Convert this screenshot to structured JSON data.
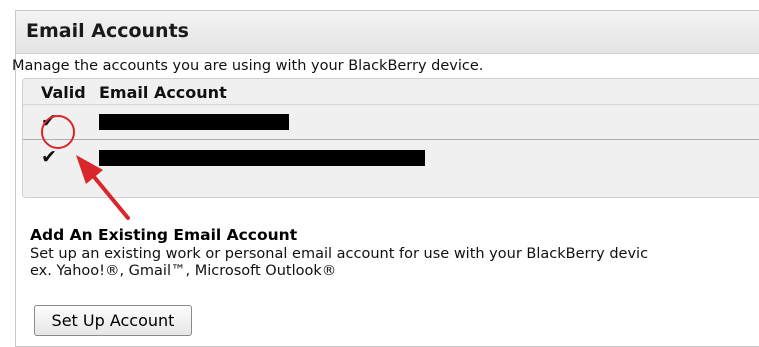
{
  "panel": {
    "title": "Email Accounts",
    "description": "Manage the accounts you are using with your BlackBerry device."
  },
  "accounts_table": {
    "headers": {
      "valid": "Valid",
      "email": "Email Account"
    },
    "rows": [
      {
        "valid_mark": "✔",
        "email": "[redacted]"
      },
      {
        "valid_mark": "✔",
        "email": "[redacted]"
      }
    ]
  },
  "add_section": {
    "title": "Add An Existing Email Account",
    "line1": "Set up an existing work or personal email account for use with your BlackBerry devic",
    "line2": "ex. Yahoo!®, Gmail™, Microsoft Outlook®",
    "button_label": "Set Up Account"
  },
  "annotation": {
    "color": "#d9262a",
    "icons": [
      "highlight-circle",
      "pointer-arrow"
    ]
  }
}
